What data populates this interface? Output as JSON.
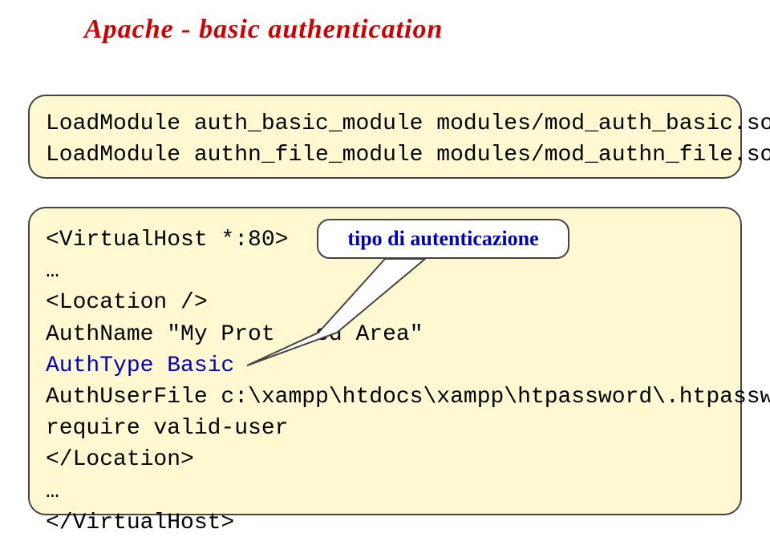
{
  "title": "Apache - basic authentication",
  "box1": {
    "line1": "LoadModule auth_basic_module modules/mod_auth_basic.so",
    "line2": "LoadModule authn_file_module modules/mod_authn_file.so"
  },
  "box2": {
    "l1": "<VirtualHost *:80>",
    "l2": "…",
    "l3": "  <Location />",
    "l4a": "   AuthName \"My Prot",
    "l4b": "ed Area\"",
    "l5": "   AuthType Basic",
    "l6": "   AuthUserFile c:\\xampp\\htdocs\\xampp\\htpassword\\.htpasswd",
    "l7": "   require valid-user",
    "l8": "  </Location>",
    "l9": "…",
    "l10": "</VirtualHost>"
  },
  "callout": "tipo di autenticazione"
}
